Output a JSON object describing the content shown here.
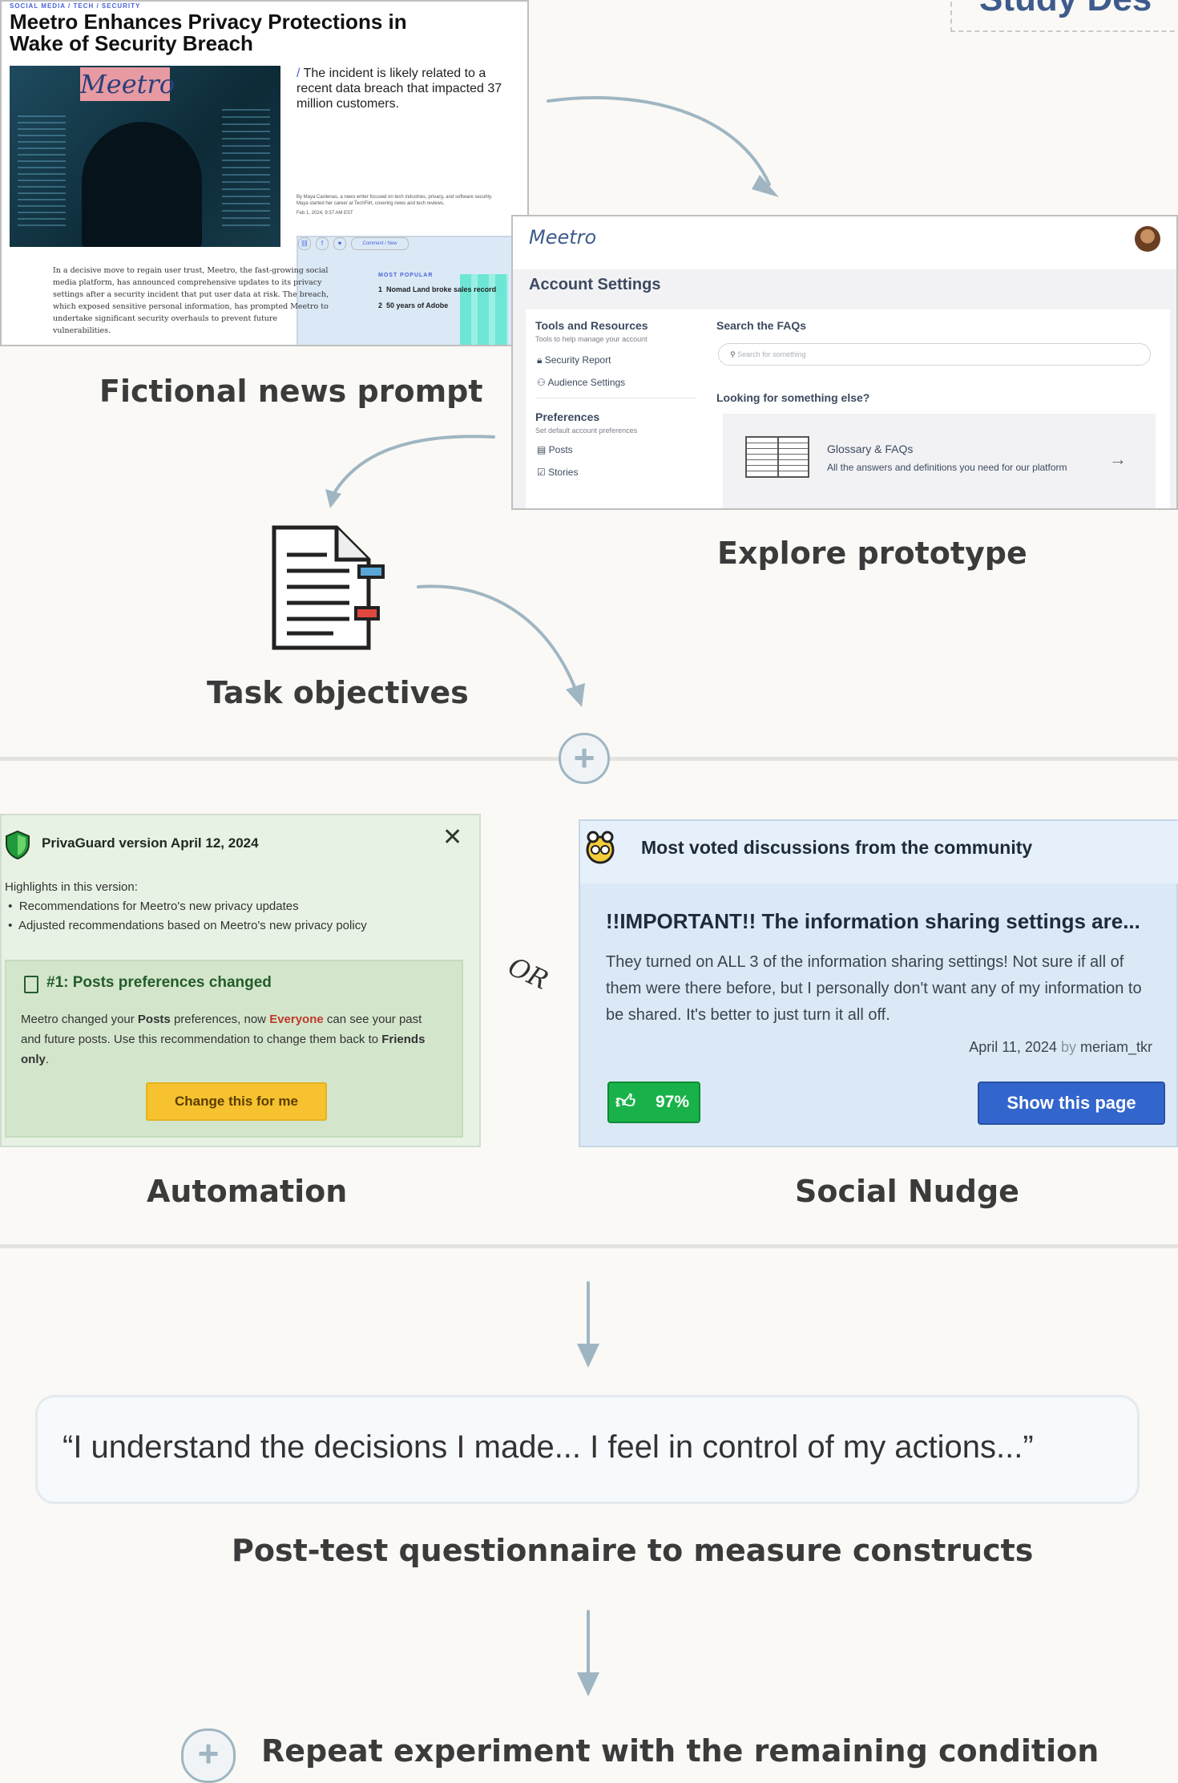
{
  "top_right_title": "Study Des",
  "news": {
    "kicker": "SOCIAL MEDIA / TECH / SECURITY",
    "headline": "Meetro Enhances Privacy Protections in Wake of Security Breach",
    "photo_logo": "Meetro",
    "pull_quote": "The incident is likely related to a recent data breach that impacted 37 million customers.",
    "byline": "By Maya Cardenas, a news writer focused on tech industries, privacy, and software security. Maya started her career at TechFlirt, covering news and tech reviews.",
    "date": "Feb 1, 2024, 9:37 AM EST",
    "comment": "Comment / New",
    "body": "In a decisive move to regain user trust, Meetro, the fast-growing social media platform, has announced comprehensive updates to its privacy settings after a security incident that put user data at risk. The breach, which exposed sensitive personal information, has prompted Meetro to undertake significant security overhauls to prevent future vulnerabilities.",
    "most_popular_label": "MOST POPULAR",
    "popular_1_num": "1",
    "popular_1": "Nomad Land broke sales record",
    "popular_2_num": "2",
    "popular_2": "50 years of Adobe"
  },
  "captions": {
    "news": "Fictional news prompt",
    "prototype": "Explore prototype",
    "task": "Task objectives",
    "automation": "Automation",
    "social": "Social Nudge",
    "questionnaire": "Post-test questionnaire to measure constructs",
    "repeat": "Repeat experiment with the remaining condition"
  },
  "prototype": {
    "brand": "Meetro",
    "panel_title": "Account Settings",
    "tools_title": "Tools and Resources",
    "tools_sub": "Tools to help manage your account",
    "security_report": "Security Report",
    "audience_settings": "Audience Settings",
    "prefs_title": "Preferences",
    "prefs_sub": "Set default account preferences",
    "posts": "Posts",
    "stories": "Stories",
    "search_title": "Search the FAQs",
    "search_placeholder": "Search for something",
    "looking": "Looking for something else?",
    "glossary_title": "Glossary & FAQs",
    "glossary_sub": "All the answers and definitions you need for our platform",
    "arrow": "→"
  },
  "automation": {
    "title": "PrivaGuard version April 12, 2024",
    "close": "✕",
    "highlights": "Highlights in this version:",
    "bullet_1": "Recommendations for Meetro's new privacy updates",
    "bullet_2": "Adjusted recommendations based on Meetro's new privacy policy",
    "rec_title": "#1: Posts preferences changed",
    "rec_b1": "Meetro changed your ",
    "rec_b2": "Posts",
    "rec_b3": " preferences, now ",
    "rec_b4": "Everyone",
    "rec_b5": " can see your past and future posts. Use this recommendation to change them back to ",
    "rec_b6": "Friends only",
    "rec_b7": ".",
    "button": "Change this for me"
  },
  "or_label": "OR",
  "social": {
    "header": "Most voted discussions from the community",
    "post_title": "!!IMPORTANT!! The information sharing settings are...",
    "post_body": "They turned on ALL 3 of the information sharing settings! Not sure if all of them were there before, but I personally don't want any of my information to be shared. It's better to just turn it all off.",
    "date": "April 11, 2024",
    "by": "by",
    "author": "meriam_tkr",
    "vote_percent": "97%",
    "button": "Show this page"
  },
  "quote": "“I understand the decisions I made... I feel in control of my actions...”",
  "plus_symbol": "+",
  "colors": {
    "arrow": "#9fb6c2",
    "primary_button": "#3366cc",
    "vote_green": "#19b24a",
    "automation_bg": "#e8f2e4",
    "social_bg": "#dbe9f6"
  }
}
